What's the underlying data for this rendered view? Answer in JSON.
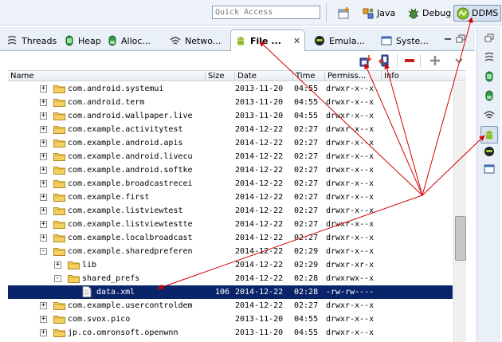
{
  "toolbar": {
    "quick_access_placeholder": "Quick Access",
    "perspectives": {
      "java": "Java",
      "debug": "Debug",
      "ddms": "DDMS"
    }
  },
  "tabs": {
    "threads": "Threads",
    "heap": "Heap",
    "alloc": "Alloc...",
    "network": "Netwo...",
    "file": "File ...",
    "emulator": "Emula...",
    "system": "Syste..."
  },
  "table": {
    "columns": {
      "name": "Name",
      "size": "Size",
      "date": "Date",
      "time": "Time",
      "permissions": "Permiss...",
      "info": "Info"
    },
    "rows": [
      {
        "name": "com.android.systemui",
        "size": "",
        "date": "2013-11-20",
        "time": "04:55",
        "perm": "drwxr-x--x",
        "level": 1,
        "type": "folder",
        "expander": "+"
      },
      {
        "name": "com.android.term",
        "size": "",
        "date": "2013-11-20",
        "time": "04:55",
        "perm": "drwxr-x--x",
        "level": 1,
        "type": "folder",
        "expander": "+"
      },
      {
        "name": "com.android.wallpaper.live",
        "size": "",
        "date": "2013-11-20",
        "time": "04:55",
        "perm": "drwxr-x--x",
        "level": 1,
        "type": "folder",
        "expander": "+"
      },
      {
        "name": "com.example.activitytest",
        "size": "",
        "date": "2014-12-22",
        "time": "02:27",
        "perm": "drwxr-x--x",
        "level": 1,
        "type": "folder",
        "expander": "+"
      },
      {
        "name": "com.example.android.apis",
        "size": "",
        "date": "2014-12-22",
        "time": "02:27",
        "perm": "drwxr-x--x",
        "level": 1,
        "type": "folder",
        "expander": "+"
      },
      {
        "name": "com.example.android.livecu",
        "size": "",
        "date": "2014-12-22",
        "time": "02:27",
        "perm": "drwxr-x--x",
        "level": 1,
        "type": "folder",
        "expander": "+"
      },
      {
        "name": "com.example.android.softke",
        "size": "",
        "date": "2014-12-22",
        "time": "02:27",
        "perm": "drwxr-x--x",
        "level": 1,
        "type": "folder",
        "expander": "+"
      },
      {
        "name": "com.example.broadcastrecei",
        "size": "",
        "date": "2014-12-22",
        "time": "02:27",
        "perm": "drwxr-x--x",
        "level": 1,
        "type": "folder",
        "expander": "+"
      },
      {
        "name": "com.example.first",
        "size": "",
        "date": "2014-12-22",
        "time": "02:27",
        "perm": "drwxr-x--x",
        "level": 1,
        "type": "folder",
        "expander": "+"
      },
      {
        "name": "com.example.listviewtest",
        "size": "",
        "date": "2014-12-22",
        "time": "02:27",
        "perm": "drwxr-x--x",
        "level": 1,
        "type": "folder",
        "expander": "+"
      },
      {
        "name": "com.example.listviewtestte",
        "size": "",
        "date": "2014-12-22",
        "time": "02:27",
        "perm": "drwxr-x--x",
        "level": 1,
        "type": "folder",
        "expander": "+"
      },
      {
        "name": "com.example.localbroadcast",
        "size": "",
        "date": "2014-12-22",
        "time": "02:27",
        "perm": "drwxr-x--x",
        "level": 1,
        "type": "folder",
        "expander": "+"
      },
      {
        "name": "com.example.sharedpreferen",
        "size": "",
        "date": "2014-12-22",
        "time": "02:29",
        "perm": "drwxr-x--x",
        "level": 1,
        "type": "folder",
        "expander": "-"
      },
      {
        "name": "lib",
        "size": "",
        "date": "2014-12-22",
        "time": "02:29",
        "perm": "drwxr-xr-x",
        "level": 2,
        "type": "folder",
        "expander": "+"
      },
      {
        "name": "shared_prefs",
        "size": "",
        "date": "2014-12-22",
        "time": "02:28",
        "perm": "drwxrwx--x",
        "level": 2,
        "type": "folder",
        "expander": "-"
      },
      {
        "name": "data.xml",
        "size": "106",
        "date": "2014-12-22",
        "time": "02:28",
        "perm": "-rw-rw----",
        "level": 3,
        "type": "file",
        "expander": "",
        "selected": true
      },
      {
        "name": "com.example.usercontroldem",
        "size": "",
        "date": "2014-12-22",
        "time": "02:27",
        "perm": "drwxr-x--x",
        "level": 1,
        "type": "folder",
        "expander": "+"
      },
      {
        "name": "com.svox.pico",
        "size": "",
        "date": "2013-11-20",
        "time": "04:55",
        "perm": "drwxr-x--x",
        "level": 1,
        "type": "folder",
        "expander": "+"
      },
      {
        "name": "jp.co.omronsoft.openwnn",
        "size": "",
        "date": "2013-11-20",
        "time": "04:55",
        "perm": "drwxr-x--x",
        "level": 1,
        "type": "folder",
        "expander": "+"
      }
    ]
  },
  "colors": {
    "selection": "#0a246a",
    "annotation_arrow": "#d40000",
    "folder": "#f0c040",
    "android_green": "#8cbf26"
  }
}
